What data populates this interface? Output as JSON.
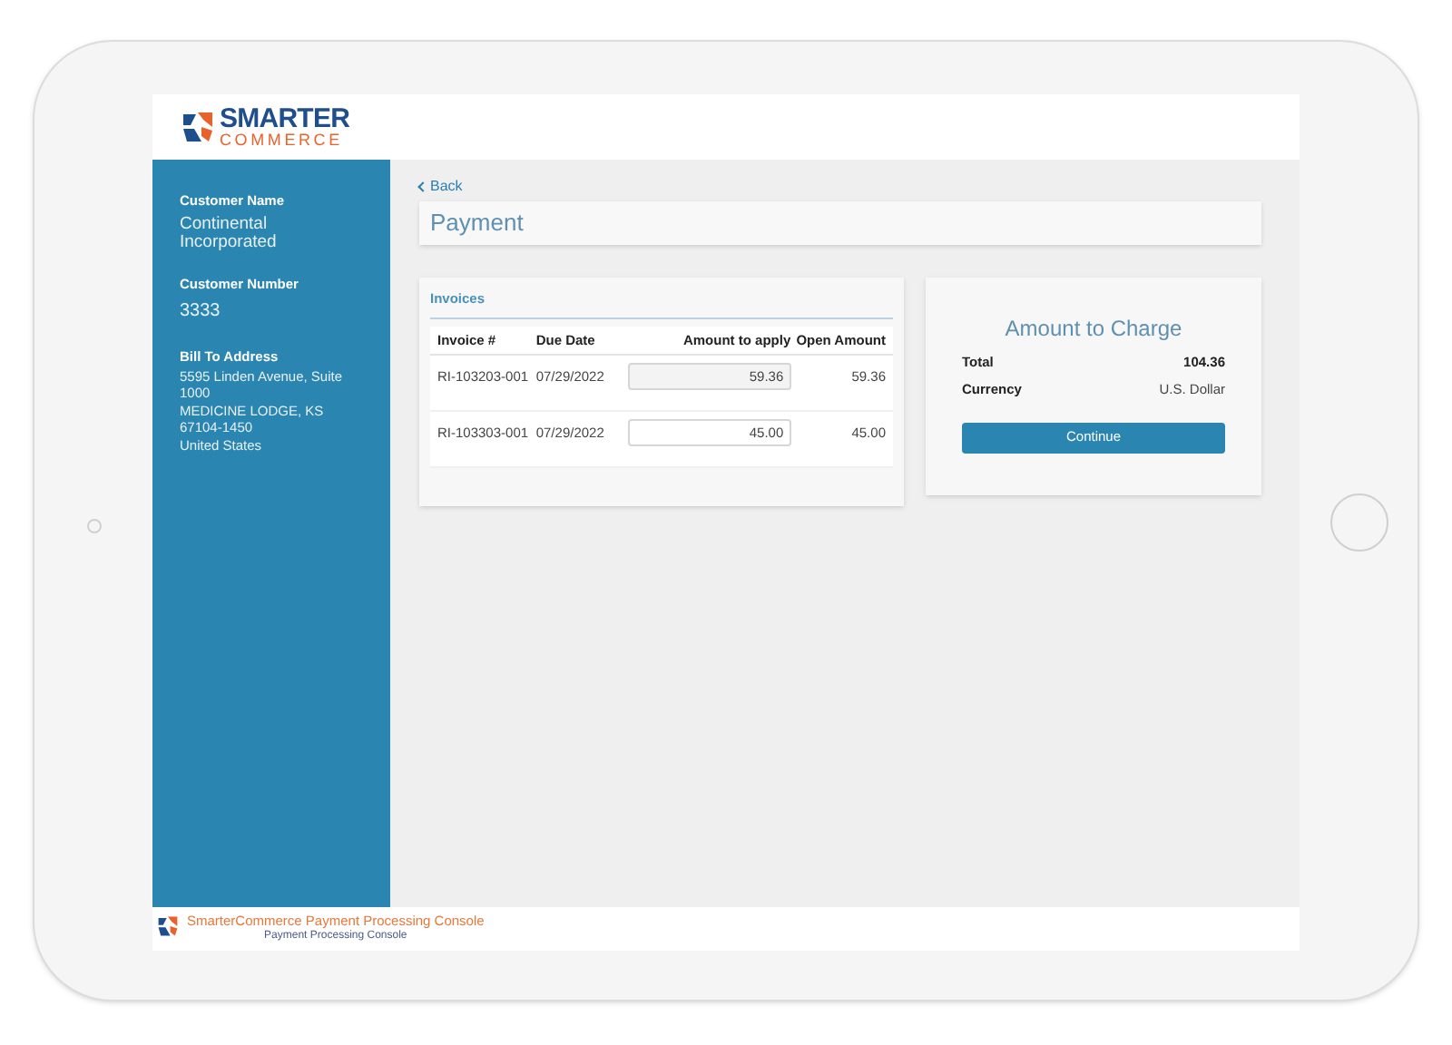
{
  "header": {
    "logo_top": "SMARTER",
    "logo_bottom": "COMMERCE"
  },
  "sidebar": {
    "customer_name_label": "Customer Name",
    "customer_name": "Continental Incorporated",
    "customer_number_label": "Customer Number",
    "customer_number": "3333",
    "bill_to_label": "Bill To Address",
    "address_lines": [
      "5595 Linden Avenue, Suite 1000",
      "MEDICINE LODGE, KS 67104-1450",
      "United States"
    ]
  },
  "back_link": "Back",
  "page_title": "Payment",
  "invoices": {
    "title": "Invoices",
    "columns": [
      "Invoice #",
      "Due Date",
      "Amount to apply",
      "Open Amount"
    ],
    "rows": [
      {
        "invoice": "RI-103203-001",
        "due_date": "07/29/2022",
        "amount_to_apply": "59.36",
        "open_amount": "59.36",
        "disabled": true
      },
      {
        "invoice": "RI-103303-001",
        "due_date": "07/29/2022",
        "amount_to_apply": "45.00",
        "open_amount": "45.00",
        "disabled": false
      }
    ]
  },
  "charge": {
    "title": "Amount to Charge",
    "rows": [
      {
        "label": "Total",
        "value": "104.36"
      },
      {
        "label": "Currency",
        "value": "U.S. Dollar"
      }
    ],
    "button": "Continue"
  },
  "footer": {
    "title": "SmarterCommerce Payment Processing Console",
    "subtitle": "Payment Processing Console"
  }
}
